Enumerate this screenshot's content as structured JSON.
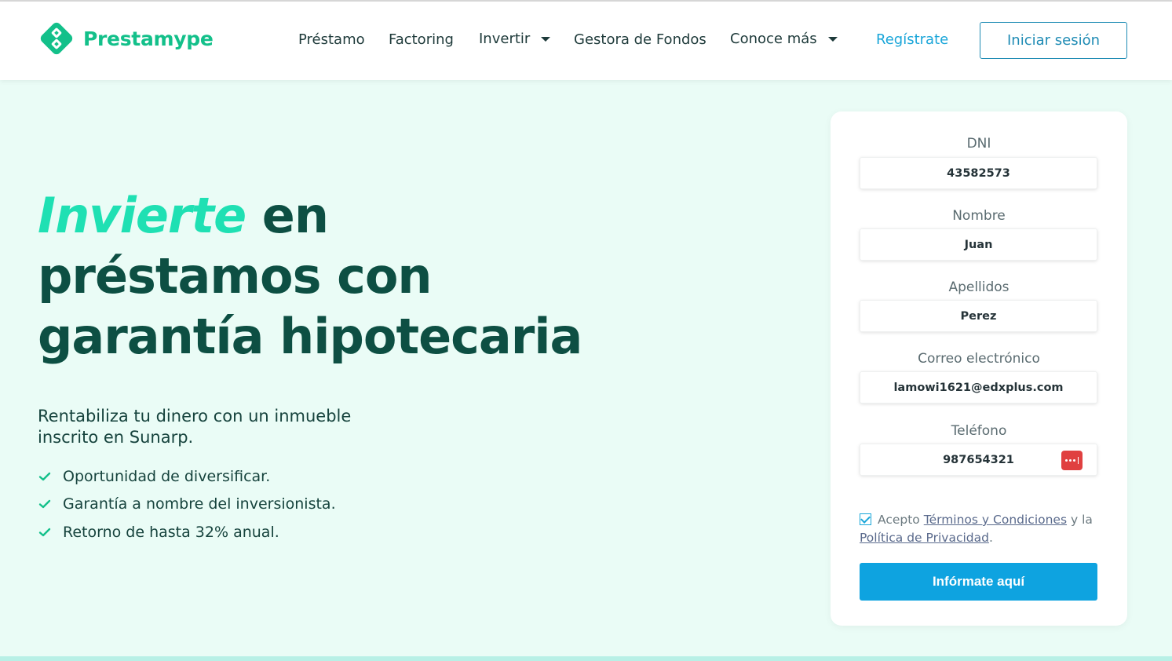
{
  "brand": {
    "name": "Prestamype",
    "primary_color": "#13c08a",
    "accent_color": "#1fe0b3",
    "link_color": "#1aa6d9"
  },
  "nav": {
    "items": [
      {
        "label": "Préstamo",
        "has_dropdown": false
      },
      {
        "label": "Factoring",
        "has_dropdown": false
      },
      {
        "label": "Invertir",
        "has_dropdown": true
      },
      {
        "label": "Gestora de Fondos",
        "has_dropdown": false
      },
      {
        "label": "Conoce más",
        "has_dropdown": true
      }
    ],
    "register_label": "Regístrate",
    "login_label": "Iniciar sesión"
  },
  "hero": {
    "title_accent": "Invierte",
    "title_rest_1": " en",
    "title_line_2": "préstamos con",
    "title_line_3": "garantía hipotecaria",
    "subtitle": "Rentabiliza tu dinero con un inmueble inscrito en Sunarp.",
    "benefits": [
      "Oportunidad de diversificar.",
      "Garantía a nombre del inversionista.",
      "Retorno de hasta 32% anual."
    ]
  },
  "form": {
    "fields": [
      {
        "label": "DNI",
        "value": "43582573"
      },
      {
        "label": "Nombre",
        "value": "Juan"
      },
      {
        "label": "Apellidos",
        "value": "Perez"
      },
      {
        "label": "Correo electrónico",
        "value": "lamowi1621@edxplus.com"
      },
      {
        "label": "Teléfono",
        "value": "987654321"
      }
    ],
    "terms_prefix": "Acepto",
    "terms_link": "Términos y Condiciones",
    "terms_mid": "y la",
    "privacy_link": "Política de Privacidad",
    "terms_suffix": ".",
    "terms_checked": true,
    "submit_label": "Infórmate aquí"
  }
}
